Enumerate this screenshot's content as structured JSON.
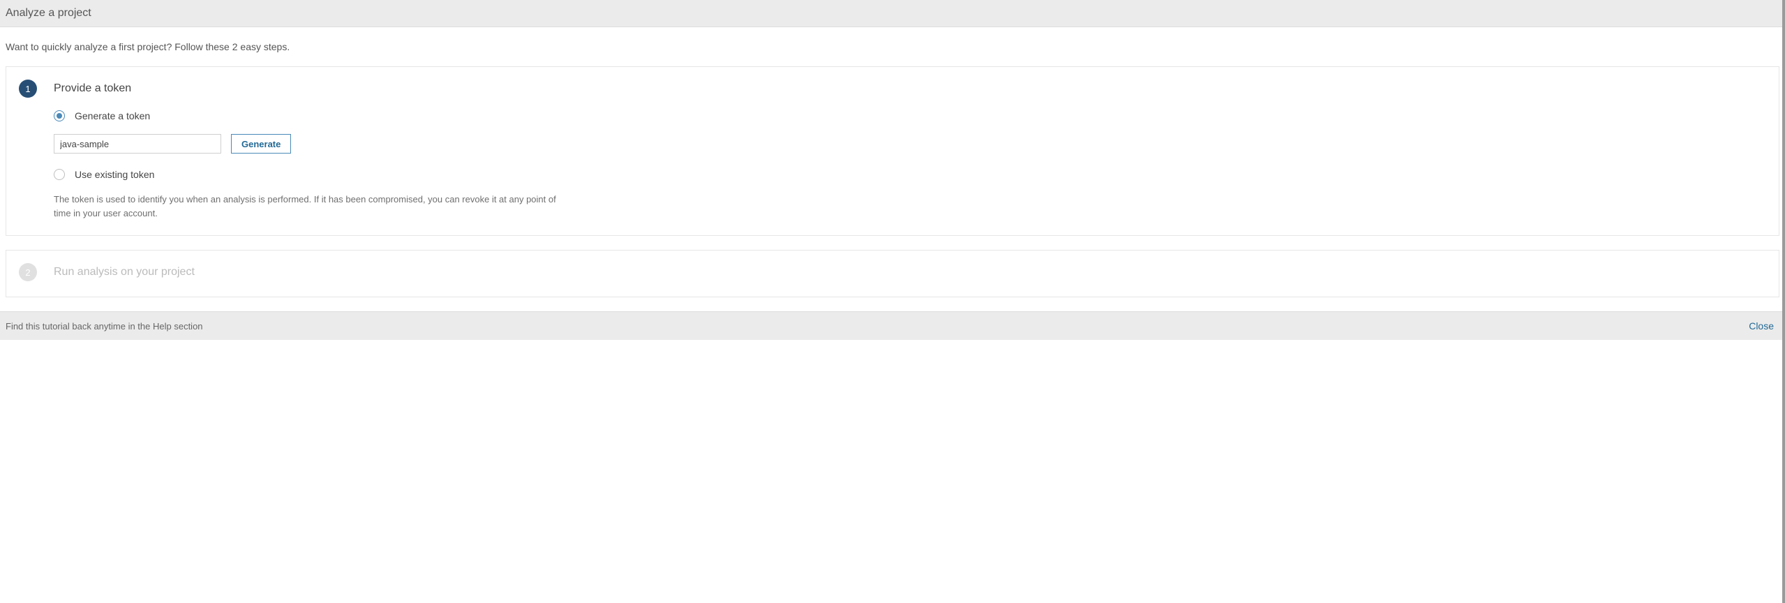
{
  "header": {
    "title": "Analyze a project"
  },
  "intro": "Want to quickly analyze a first project? Follow these 2 easy steps.",
  "step1": {
    "number": "1",
    "title": "Provide a token",
    "generate_option_label": "Generate a token",
    "use_existing_option_label": "Use existing token",
    "token_input_value": "java-sample",
    "generate_button_label": "Generate",
    "help_text": "The token is used to identify you when an analysis is performed. If it has been compromised, you can revoke it at any point of time in your user account."
  },
  "step2": {
    "number": "2",
    "title": "Run analysis on your project"
  },
  "footer": {
    "help_hint": "Find this tutorial back anytime in the Help section",
    "close_label": "Close"
  }
}
